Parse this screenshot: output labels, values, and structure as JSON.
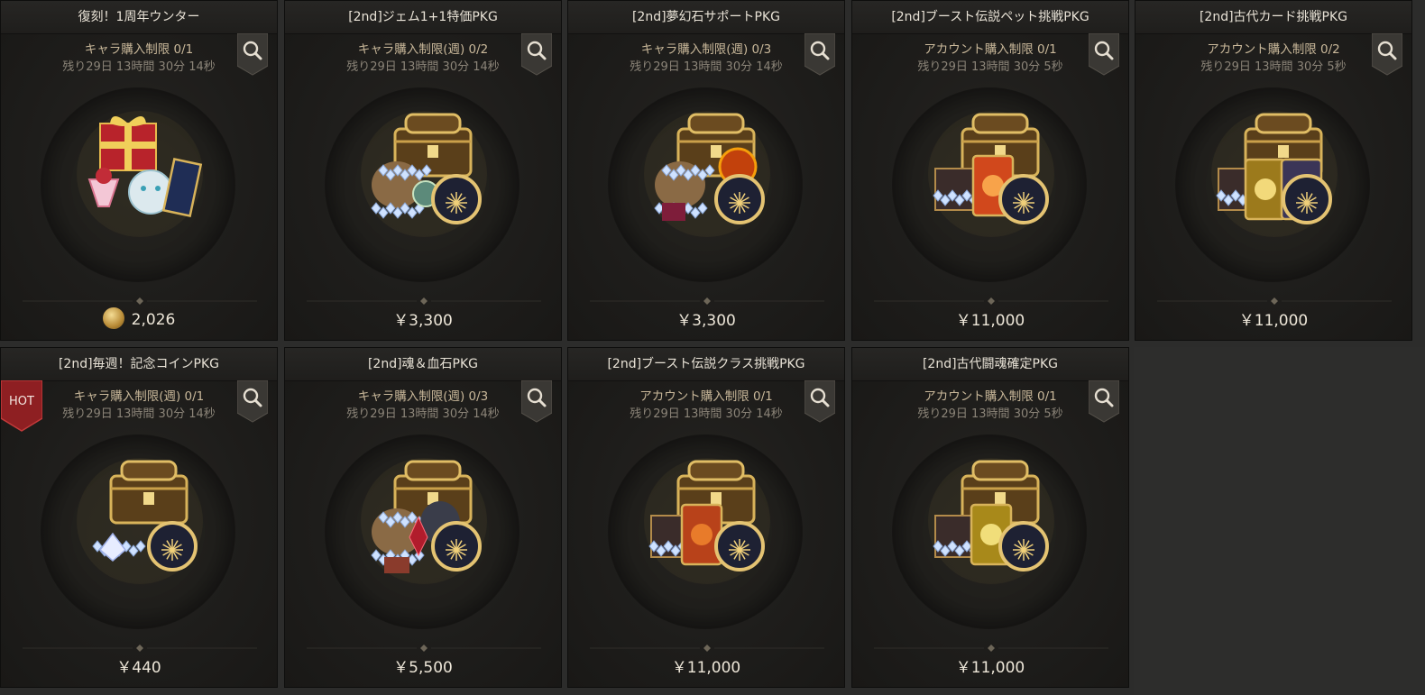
{
  "packages": [
    {
      "title": "復刻！1周年ウンター",
      "limit": "キャラ購入制限 0/1",
      "remaining": "残り29日 13時間 30分 14秒",
      "price": "2,026",
      "currency": "coin",
      "art": "gift-cat",
      "hot": false
    },
    {
      "title": "[2nd]ジェム1+1特価PKG",
      "limit": "キャラ購入制限(週) 0/2",
      "remaining": "残り29日 13時間 30分 14秒",
      "price": "￥3,300",
      "currency": "yen",
      "art": "chest-gems",
      "hot": false
    },
    {
      "title": "[2nd]夢幻石サポートPKG",
      "limit": "キャラ購入制限(週) 0/3",
      "remaining": "残り29日 13時間 30分 14秒",
      "price": "￥3,300",
      "currency": "yen",
      "art": "chest-orb",
      "hot": false
    },
    {
      "title": "[2nd]ブースト伝説ペット挑戦PKG",
      "limit": "アカウント購入制限 0/1",
      "remaining": "残り29日 13時間 30分 5秒",
      "price": "￥11,000",
      "currency": "yen",
      "art": "chest-pet-card",
      "hot": false
    },
    {
      "title": "[2nd]古代カード挑戦PKG",
      "limit": "アカウント購入制限 0/2",
      "remaining": "残り29日 13時間 30分 5秒",
      "price": "￥11,000",
      "currency": "yen",
      "art": "chest-ancient-cards",
      "hot": false
    },
    {
      "title": "[2nd]毎週！記念コインPKG",
      "limit": "キャラ購入制限(週) 0/1",
      "remaining": "残り29日 13時間 30分 14秒",
      "price": "￥440",
      "currency": "yen",
      "art": "chest-coin",
      "hot": true
    },
    {
      "title": "[2nd]魂＆血石PKG",
      "limit": "キャラ購入制限(週) 0/3",
      "remaining": "残り29日 13時間 30分 14秒",
      "price": "￥5,500",
      "currency": "yen",
      "art": "chest-bloodstone",
      "hot": false
    },
    {
      "title": "[2nd]ブースト伝説クラス挑戦PKG",
      "limit": "アカウント購入制限 0/1",
      "remaining": "残り29日 13時間 30分 14秒",
      "price": "￥11,000",
      "currency": "yen",
      "art": "chest-class-card",
      "hot": false
    },
    {
      "title": "[2nd]古代闘魂確定PKG",
      "limit": "アカウント購入制限 0/1",
      "remaining": "残り29日 13時間 30分 5秒",
      "price": "￥11,000",
      "currency": "yen",
      "art": "chest-gold-card",
      "hot": false
    }
  ],
  "hot_label": "HOT",
  "colors": {
    "gold": "#d8b35a",
    "card_bg": "#1e1d1b",
    "limit_text": "#c9b89a",
    "price_text": "#ede6d8",
    "hot_red": "#8e1f22"
  }
}
